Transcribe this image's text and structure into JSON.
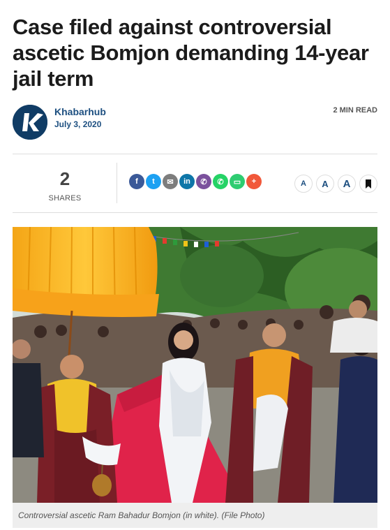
{
  "article": {
    "headline": "Case filed against controversial ascetic Bomjon demanding 14-year jail term",
    "author": "Khabarhub",
    "date": "July 3, 2020",
    "read_time": "2 MIN READ"
  },
  "share": {
    "count": "2",
    "label": "SHARES",
    "buttons": [
      {
        "name": "facebook",
        "glyph": "f",
        "color": "#3b5998"
      },
      {
        "name": "twitter",
        "glyph": "t",
        "color": "#1da1f2"
      },
      {
        "name": "email",
        "glyph": "✉",
        "color": "#7d7d7d"
      },
      {
        "name": "linkedin",
        "glyph": "in",
        "color": "#0e76a8"
      },
      {
        "name": "viber",
        "glyph": "✆",
        "color": "#7b519d"
      },
      {
        "name": "whatsapp",
        "glyph": "✆",
        "color": "#25d366"
      },
      {
        "name": "sms",
        "glyph": "▭",
        "color": "#2ecc71"
      },
      {
        "name": "more",
        "glyph": "+",
        "color": "#f1583a"
      }
    ]
  },
  "font_tools": {
    "small": "A",
    "medium": "A",
    "large": "A"
  },
  "photo": {
    "caption": "Controversial ascetic Ram Bahadur Bomjon (in white). (File Photo)"
  }
}
